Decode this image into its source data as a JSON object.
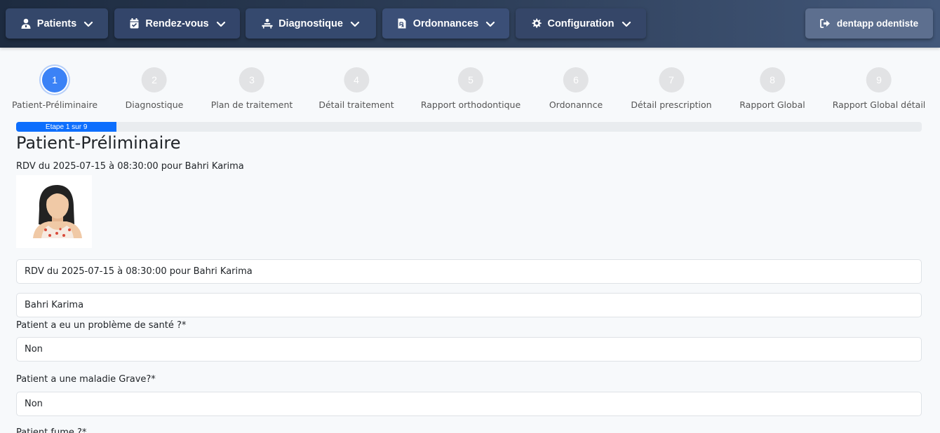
{
  "nav": {
    "patients": "Patients",
    "rendezvous": "Rendez-vous",
    "diagnostique": "Diagnostique",
    "ordonnances": "Ordonnances",
    "configuration": "Configuration",
    "user": "dentapp odentiste"
  },
  "steps": [
    {
      "num": "1",
      "label": "Patient-Préliminaire"
    },
    {
      "num": "2",
      "label": "Diagnostique"
    },
    {
      "num": "3",
      "label": "Plan de traitement"
    },
    {
      "num": "4",
      "label": "Détail traitement"
    },
    {
      "num": "5",
      "label": "Rapport orthodontique"
    },
    {
      "num": "6",
      "label": "Ordonannce"
    },
    {
      "num": "7",
      "label": "Détail prescription"
    },
    {
      "num": "8",
      "label": "Rapport Global"
    },
    {
      "num": "9",
      "label": "Rapport Global détail"
    }
  ],
  "progress": {
    "label": "Etape 1 sur 9",
    "fraction": 0.111
  },
  "page": {
    "title": "Patient-Préliminaire",
    "rdv_text": "RDV du 2025-07-15 à 08:30:00 pour Bahri Karima"
  },
  "form": {
    "rdv_value": "RDV du 2025-07-15 à 08:30:00 pour Bahri Karima",
    "patient_value": "Bahri Karima",
    "q1_label": "Patient a eu un problème de santé ?*",
    "q1_value": "Non",
    "q2_label": "Patient a une maladie Grave?*",
    "q2_value": "Non",
    "q3_label": "Patient fume ?*"
  },
  "colors": {
    "active_step": "#3b82f6",
    "progress": "#0d6efd",
    "navbar": "#2d3e58"
  },
  "icons": [
    "user-doctor-icon",
    "calendar-check-icon",
    "procedures-icon",
    "prescription-file-icon",
    "gear-icon",
    "sign-out-icon",
    "chevron-down-icon"
  ]
}
